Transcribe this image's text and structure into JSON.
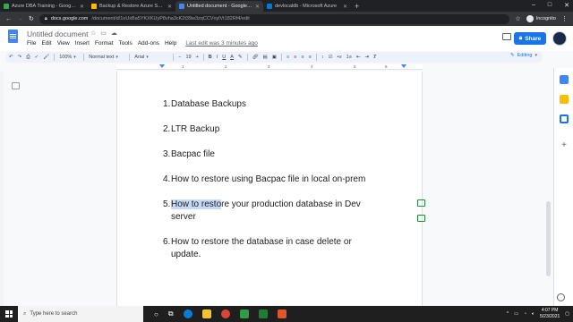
{
  "browser": {
    "tabs": [
      {
        "title": "Azure DBA Training - Google Dr...",
        "favicon_color": "#34a853",
        "active": false
      },
      {
        "title": "Backup & Restore Azure SQL Dat...",
        "favicon_color": "#fbbc04",
        "active": false
      },
      {
        "title": "Untitled document - Google Doc...",
        "favicon_color": "#4285f4",
        "active": true
      },
      {
        "title": "devlocaldb - Microsoft Azure",
        "favicon_color": "#0078d4",
        "active": false
      }
    ],
    "new_tab": "+",
    "url_host": "docs.google.com",
    "url_path": "/document/d/1oUxBa5YKXKUyP8vha3cK2t39w3zqCCVnylVt182Rf4/edit",
    "profile_label": "Incognito"
  },
  "docs": {
    "title": "Untitled document",
    "menu": [
      "File",
      "Edit",
      "View",
      "Insert",
      "Format",
      "Tools",
      "Add-ons",
      "Help"
    ],
    "last_edit": "Last edit was 3 minutes ago",
    "share_label": "Share",
    "share_icon": "lock-icon",
    "brand_color": "#1a73e8"
  },
  "toolbar": {
    "zoom": "100%",
    "style": "Normal text",
    "font": "Arial",
    "font_size": "19",
    "bold": "B",
    "italic": "I",
    "underline": "U",
    "text_color": "A",
    "mode": "Editing"
  },
  "ruler": {
    "numbers": [
      "1",
      "2",
      "3",
      "4",
      "5",
      "6",
      "7"
    ]
  },
  "document": {
    "items": [
      {
        "num": "1.",
        "text": "Database Backups"
      },
      {
        "num": "2.",
        "text": "LTR Backup"
      },
      {
        "num": "3.",
        "text": "Bacpac file"
      },
      {
        "num": "4.",
        "text": " How to restore using Bacpac file in local on-prem"
      },
      {
        "num": "5.",
        "highlight": " How to resto",
        "text": "re your production database in Dev server"
      },
      {
        "num": "6.",
        "text": "How to restore the database in case delete or update."
      }
    ]
  },
  "taskbar": {
    "search_placeholder": "Type here to search",
    "time": "4:07 PM",
    "date": "5/23/2021"
  }
}
